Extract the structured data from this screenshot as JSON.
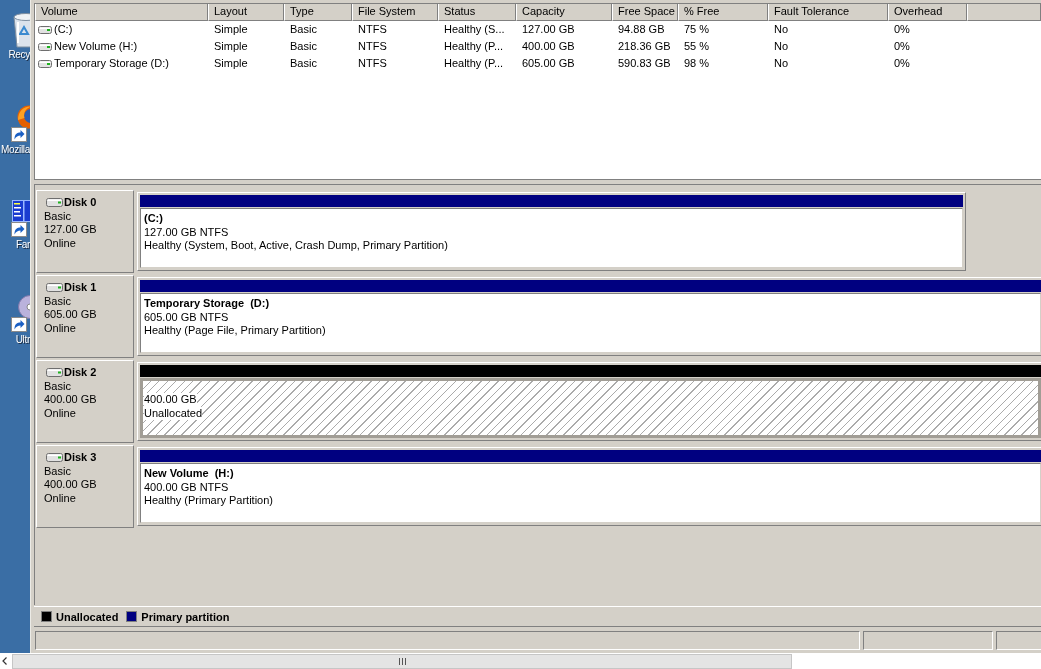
{
  "desktop": {
    "icons": [
      {
        "kind": "bin",
        "label": "Recy",
        "shortcut": false
      },
      {
        "kind": "browser",
        "label": "Mozilla",
        "shortcut": true
      },
      {
        "kind": "panel",
        "label": "Far",
        "shortcut": true
      },
      {
        "kind": "disc",
        "label": "Ultr",
        "shortcut": true
      }
    ]
  },
  "volume_list": {
    "columns": [
      "Volume",
      "Layout",
      "Type",
      "File System",
      "Status",
      "Capacity",
      "Free Space",
      "% Free",
      "Fault Tolerance",
      "Overhead"
    ],
    "rows": [
      {
        "cells": [
          "(C:)",
          "Simple",
          "Basic",
          "NTFS",
          "Healthy (S...",
          "127.00 GB",
          "94.88 GB",
          "75 %",
          "No",
          "0%"
        ]
      },
      {
        "cells": [
          "New Volume (H:)",
          "Simple",
          "Basic",
          "NTFS",
          "Healthy (P...",
          "400.00 GB",
          "218.36 GB",
          "55 %",
          "No",
          "0%"
        ]
      },
      {
        "cells": [
          "Temporary Storage (D:)",
          "Simple",
          "Basic",
          "NTFS",
          "Healthy (P...",
          "605.00 GB",
          "590.83 GB",
          "98 %",
          "No",
          "0%"
        ]
      }
    ]
  },
  "disks": [
    {
      "name": "Disk 0",
      "type": "Basic",
      "size": "127.00 GB",
      "status": "Online",
      "partitions": [
        {
          "kind": "primary",
          "name": "(C:)",
          "size": "127.00 GB NTFS",
          "status": "Healthy (System, Boot, Active, Crash Dump, Primary Partition)",
          "cut_off": false
        }
      ]
    },
    {
      "name": "Disk 1",
      "type": "Basic",
      "size": "605.00 GB",
      "status": "Online",
      "partitions": [
        {
          "kind": "primary",
          "name": "Temporary Storage  (D:)",
          "size": "605.00 GB NTFS",
          "status": "Healthy (Page File, Primary Partition)",
          "cut_off": true
        }
      ]
    },
    {
      "name": "Disk 2",
      "type": "Basic",
      "size": "400.00 GB",
      "status": "Online",
      "partitions": [
        {
          "kind": "unallocated",
          "size": "400.00 GB",
          "status": "Unallocated",
          "cut_off": true
        }
      ]
    },
    {
      "name": "Disk 3",
      "type": "Basic",
      "size": "400.00 GB",
      "status": "Online",
      "partitions": [
        {
          "kind": "primary",
          "name": "New Volume  (H:)",
          "size": "400.00 GB NTFS",
          "status": "Healthy (Primary Partition)",
          "cut_off": true
        }
      ]
    }
  ],
  "legend": [
    {
      "label": "Unallocated",
      "color": "#000000"
    },
    {
      "label": "Primary partition",
      "color": "#000080"
    }
  ]
}
